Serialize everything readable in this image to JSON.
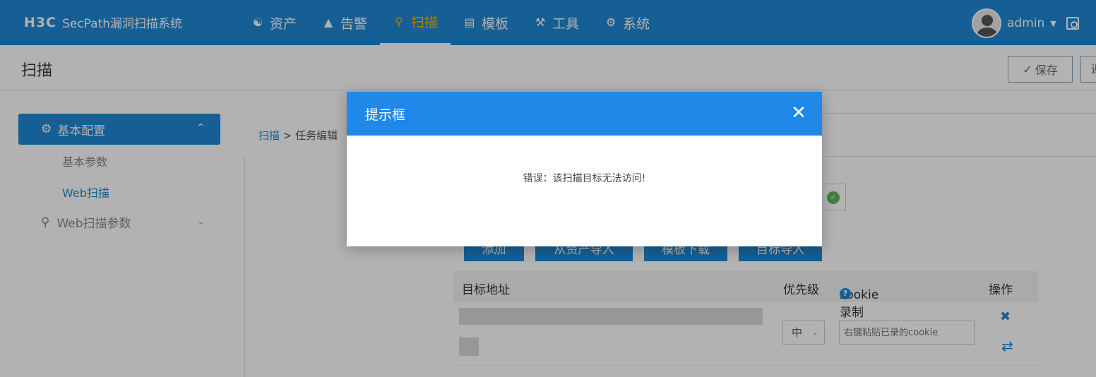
{
  "app": {
    "logo": "H3C",
    "product": "SecPath漏洞扫描系统"
  },
  "nav": {
    "items": [
      {
        "label": "资产",
        "icon": "users-icon"
      },
      {
        "label": "告警",
        "icon": "warning-icon"
      },
      {
        "label": "扫描",
        "icon": "scan-search-icon",
        "active": true
      },
      {
        "label": "模板",
        "icon": "template-icon"
      },
      {
        "label": "工具",
        "icon": "wrench-icon"
      },
      {
        "label": "系统",
        "icon": "gear-icon"
      }
    ]
  },
  "user": {
    "name": "admin"
  },
  "page": {
    "title": "扫描",
    "save_label": "保存",
    "return_label": "返"
  },
  "sidebar": {
    "group_active": "基本配置",
    "sub_items": [
      "基本参数",
      "Web扫描"
    ],
    "group_collapsed": "Web扫描参数"
  },
  "breadcrumb": {
    "root": "扫描",
    "separator": ">",
    "current": "任务编辑"
  },
  "actions": {
    "add": "添加",
    "import_assets": "从资产导入",
    "download_template": "模板下载",
    "import_targets": "目标导入"
  },
  "table": {
    "headers": {
      "target": "目标地址",
      "priority": "优先级",
      "cookie": "cookie录制",
      "ops": "操作"
    },
    "row": {
      "priority": "中",
      "cookie_placeholder": "右键粘贴已录的cookie"
    }
  },
  "modal": {
    "title": "提示框",
    "message": "错误：该扫描目标无法访问!"
  },
  "colors": {
    "brand_blue": "#1f88d6",
    "active_nav": "#ffb400",
    "success": "#5cb85c"
  }
}
